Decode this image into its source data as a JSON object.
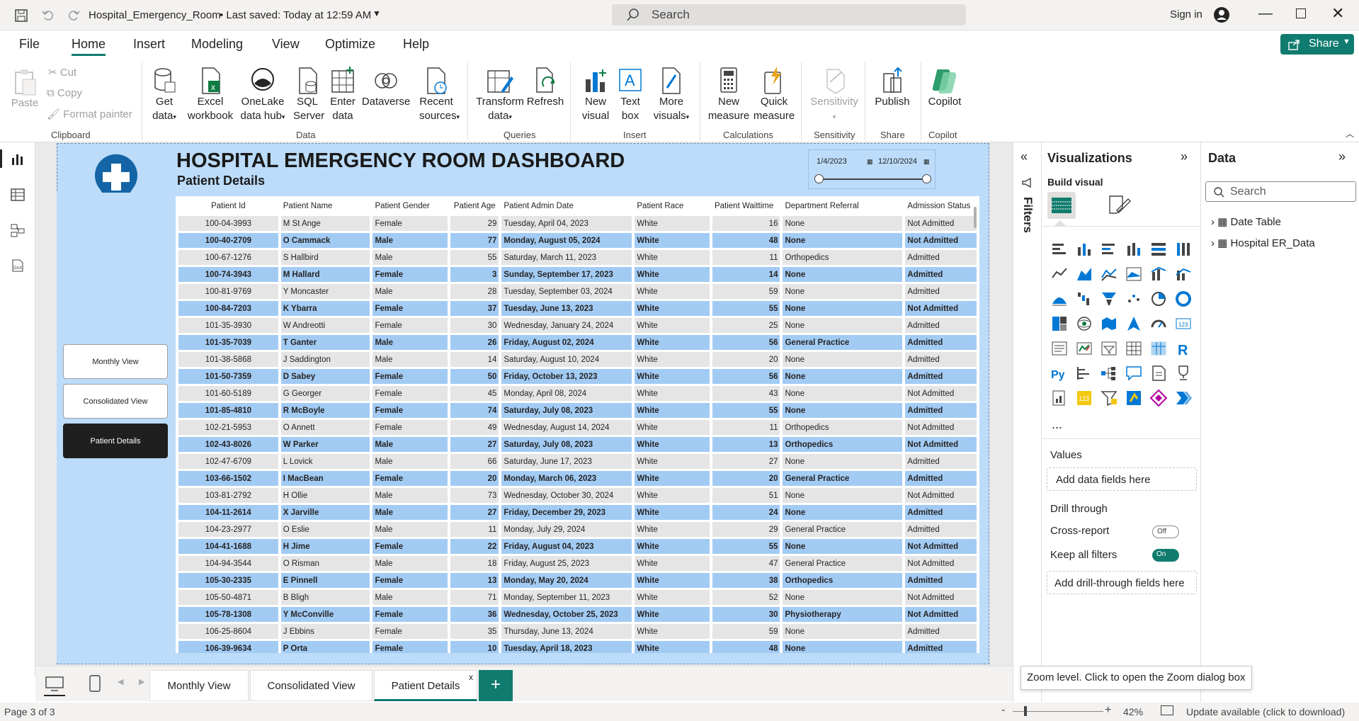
{
  "titlebar": {
    "filename": "Hospital_Emergency_Room",
    "saved": "• Last saved: Today at 12:59 AM",
    "search": "Search",
    "signin": "Sign in"
  },
  "menu": {
    "file": "File",
    "home": "Home",
    "insert": "Insert",
    "modeling": "Modeling",
    "view": "View",
    "optimize": "Optimize",
    "help": "Help",
    "share": "Share"
  },
  "ribbon": {
    "paste": "Paste",
    "cut": "Cut",
    "copy": "Copy",
    "format_painter": "Format painter",
    "clipboard": "Clipboard",
    "get_data": [
      "Get",
      "data"
    ],
    "excel": [
      "Excel",
      "workbook"
    ],
    "onelake": [
      "OneLake",
      "data hub"
    ],
    "sql": [
      "SQL",
      "Server"
    ],
    "enter": [
      "Enter",
      "data"
    ],
    "dataverse": "Dataverse",
    "recent": [
      "Recent",
      "sources"
    ],
    "data_group": "Data",
    "transform": [
      "Transform",
      "data"
    ],
    "refresh": "Refresh",
    "queries": "Queries",
    "new_visual": [
      "New",
      "visual"
    ],
    "text_box": [
      "Text",
      "box"
    ],
    "more_visuals": [
      "More",
      "visuals"
    ],
    "insert_group": "Insert",
    "new_measure": [
      "New",
      "measure"
    ],
    "quick_measure": [
      "Quick",
      "measure"
    ],
    "calculations": "Calculations",
    "sensitivity": "Sensitivity",
    "sensitivity_group": "Sensitivity",
    "publish": "Publish",
    "share_group": "Share",
    "copilot": "Copilot",
    "copilot_group": "Copilot"
  },
  "report": {
    "title": "HOSPITAL EMERGENCY ROOM DASHBOARD",
    "subtitle": "Patient Details",
    "slicer": {
      "start": "1/4/2023",
      "end": "12/10/2024"
    },
    "nav": [
      "Monthly View",
      "Consolidated View",
      "Patient Details"
    ],
    "columns": [
      "Patient Id",
      "Patient Name",
      "Patient Gender",
      "Patient Age",
      "Patient Admin Date",
      "Patient Race",
      "Patient Waittime",
      "Department Referral",
      "Admission Status"
    ],
    "rows": [
      [
        "100-04-3993",
        "M St Ange",
        "Female",
        "29",
        "Tuesday, April 04, 2023",
        "White",
        "16",
        "None",
        "Not Admitted"
      ],
      [
        "100-40-2709",
        "O Cammack",
        "Male",
        "77",
        "Monday, August 05, 2024",
        "White",
        "48",
        "None",
        "Not Admitted"
      ],
      [
        "100-67-1276",
        "S Hallbird",
        "Male",
        "55",
        "Saturday, March 11, 2023",
        "White",
        "11",
        "Orthopedics",
        "Admitted"
      ],
      [
        "100-74-3943",
        "M Hallard",
        "Female",
        "3",
        "Sunday, September 17, 2023",
        "White",
        "14",
        "None",
        "Admitted"
      ],
      [
        "100-81-9769",
        "Y Moncaster",
        "Male",
        "28",
        "Tuesday, September 03, 2024",
        "White",
        "59",
        "None",
        "Admitted"
      ],
      [
        "100-84-7203",
        "K Ybarra",
        "Female",
        "37",
        "Tuesday, June 13, 2023",
        "White",
        "55",
        "None",
        "Not Admitted"
      ],
      [
        "101-35-3930",
        "W Andreotti",
        "Female",
        "30",
        "Wednesday, January 24, 2024",
        "White",
        "25",
        "None",
        "Admitted"
      ],
      [
        "101-35-7039",
        "T Ganter",
        "Male",
        "26",
        "Friday, August 02, 2024",
        "White",
        "56",
        "General Practice",
        "Admitted"
      ],
      [
        "101-38-5868",
        "J Saddington",
        "Male",
        "14",
        "Saturday, August 10, 2024",
        "White",
        "20",
        "None",
        "Admitted"
      ],
      [
        "101-50-7359",
        "D Sabey",
        "Female",
        "50",
        "Friday, October 13, 2023",
        "White",
        "56",
        "None",
        "Admitted"
      ],
      [
        "101-60-5189",
        "G Georger",
        "Female",
        "45",
        "Monday, April 08, 2024",
        "White",
        "43",
        "None",
        "Not Admitted"
      ],
      [
        "101-85-4810",
        "R McBoyle",
        "Female",
        "74",
        "Saturday, July 08, 2023",
        "White",
        "55",
        "None",
        "Admitted"
      ],
      [
        "102-21-5953",
        "O Annett",
        "Female",
        "49",
        "Wednesday, August 14, 2024",
        "White",
        "11",
        "Orthopedics",
        "Not Admitted"
      ],
      [
        "102-43-8026",
        "W Parker",
        "Male",
        "27",
        "Saturday, July 08, 2023",
        "White",
        "13",
        "Orthopedics",
        "Not Admitted"
      ],
      [
        "102-47-6709",
        "L Lovick",
        "Male",
        "66",
        "Saturday, June 17, 2023",
        "White",
        "27",
        "None",
        "Admitted"
      ],
      [
        "103-66-1502",
        "I MacBean",
        "Female",
        "20",
        "Monday, March 06, 2023",
        "White",
        "20",
        "General Practice",
        "Admitted"
      ],
      [
        "103-81-2792",
        "H Ollie",
        "Male",
        "73",
        "Wednesday, October 30, 2024",
        "White",
        "51",
        "None",
        "Not Admitted"
      ],
      [
        "104-11-2614",
        "X Jarville",
        "Male",
        "27",
        "Friday, December 29, 2023",
        "White",
        "24",
        "None",
        "Admitted"
      ],
      [
        "104-23-2977",
        "O Eslie",
        "Male",
        "11",
        "Monday, July 29, 2024",
        "White",
        "29",
        "General Practice",
        "Admitted"
      ],
      [
        "104-41-1688",
        "H Jime",
        "Female",
        "22",
        "Friday, August 04, 2023",
        "White",
        "55",
        "None",
        "Not Admitted"
      ],
      [
        "104-94-3544",
        "O Risman",
        "Male",
        "18",
        "Friday, August 25, 2023",
        "White",
        "47",
        "General Practice",
        "Not Admitted"
      ],
      [
        "105-30-2335",
        "E Pinnell",
        "Female",
        "13",
        "Monday, May 20, 2024",
        "White",
        "38",
        "Orthopedics",
        "Admitted"
      ],
      [
        "105-50-4871",
        "B Bligh",
        "Male",
        "71",
        "Monday, September 11, 2023",
        "White",
        "52",
        "None",
        "Not Admitted"
      ],
      [
        "105-78-1308",
        "Y McConville",
        "Female",
        "36",
        "Wednesday, October 25, 2023",
        "White",
        "30",
        "Physiotherapy",
        "Not Admitted"
      ],
      [
        "106-25-8604",
        "J Ebbins",
        "Female",
        "35",
        "Thursday, June 13, 2024",
        "White",
        "59",
        "None",
        "Admitted"
      ],
      [
        "106-39-9634",
        "P Orta",
        "Female",
        "10",
        "Tuesday, April 18, 2023",
        "White",
        "48",
        "None",
        "Admitted"
      ]
    ]
  },
  "filters": {
    "label": "Filters"
  },
  "viz": {
    "title": "Visualizations",
    "build": "Build visual",
    "values": "Values",
    "add_fields": "Add data fields here",
    "drill": "Drill through",
    "cross": "Cross-report",
    "cross_state": "Off",
    "keep": "Keep all filters",
    "keep_state": "On",
    "add_drill": "Add drill-through fields here",
    "more": "..."
  },
  "data": {
    "title": "Data",
    "search": "Search",
    "tables": [
      "Date Table",
      "Hospital ER_Data"
    ]
  },
  "tabs": [
    "Monthly View",
    "Consolidated View",
    "Patient Details"
  ],
  "status": {
    "page": "Page 3 of 3",
    "zoom": "42%",
    "update": "Update available (click to download)",
    "tooltip": "Zoom level. Click to open the Zoom dialog box"
  },
  "colors": {
    "accent": "#107c6f",
    "report_bg": "#bcdcfa",
    "row_blue": "#a2cbf4",
    "row_grey": "#e5e5e5",
    "nav_active": "#1f1f1f"
  }
}
